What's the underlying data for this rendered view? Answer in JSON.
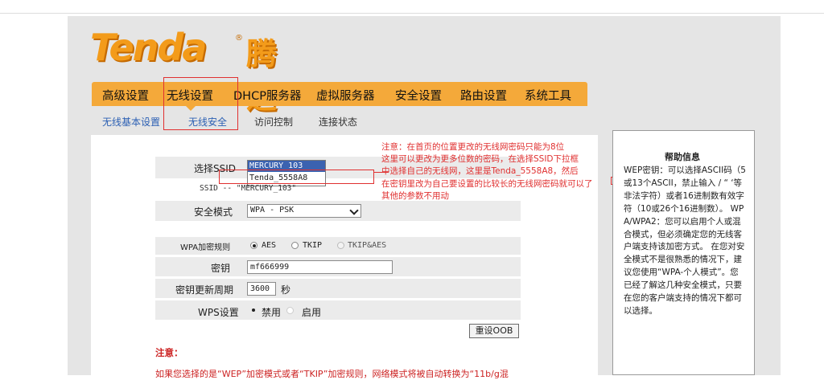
{
  "brand": {
    "logo_en": "Tenda",
    "logo_cn": "腾达",
    "registered": "®"
  },
  "main_nav": [
    {
      "label": "高级设置"
    },
    {
      "label": "无线设置"
    },
    {
      "label": "DHCP服务器"
    },
    {
      "label": "虚拟服务器"
    },
    {
      "label": "安全设置"
    },
    {
      "label": "路由设置"
    },
    {
      "label": "系统工具"
    }
  ],
  "sub_nav": [
    {
      "label": "无线基本设置"
    },
    {
      "label": "无线安全"
    },
    {
      "label": "访问控制"
    },
    {
      "label": "连接状态"
    }
  ],
  "form": {
    "ssid_label": "选择SSID",
    "ssid_options": [
      "MERCURY_103",
      "Tenda_5558A8"
    ],
    "ssid_current": "SSID -- \"MERCURY_103\"",
    "security_mode_label": "安全模式",
    "security_mode_value": "WPA - PSK",
    "wpa_rule_label": "WPA加密规则",
    "wpa_rules": [
      "AES",
      "TKIP",
      "TKIP&AES"
    ],
    "key_label": "密钥",
    "key_value": "mf666999",
    "renew_label": "密钥更新周期",
    "renew_value": "3600",
    "renew_unit": "秒",
    "wps_label": "WPS设置",
    "wps_disable": "禁用",
    "wps_enable": "启用",
    "reset_button": "重设OOB"
  },
  "annotation": {
    "lines": [
      "注意：在首页的位置更改的无线网密码只能为8位",
      "这里可以更改为更多位数的密码，在选择SSID下拉框",
      "中选择自己的无线网，这里是Tenda_5558A8，然后",
      "在密钥里改为自己要设置的比较长的无线网密码就可以了",
      "其他的参数不用动"
    ]
  },
  "notes": {
    "title": "注意：",
    "text": "如果您选择的是“WEP”加密模式或者“TKIP”加密规则，网络模式将被自动转换为“11b/g混"
  },
  "help": {
    "title": "帮助信息",
    "text": "WEP密钥：可以选择ASCII码（5或13个ASCII，禁止输入 / “ ‘等非法字符）或者16进制数有效字符（10或26个16进制数）。 WPA/WPA2：您可以启用个人或混合模式，但必须确定您的无线客户端支持该加密方式。 在您对安全模式不是很熟悉的情况下，建议您使用“WPA-个人模式”。您已经了解这几种安全模式，只要在您的客户端支持的情况下都可以选择。"
  },
  "colors": {
    "accent": "#f4a93a",
    "logo": "#f39b1a",
    "annotation": "#e03030",
    "link": "#2b5fb3"
  }
}
